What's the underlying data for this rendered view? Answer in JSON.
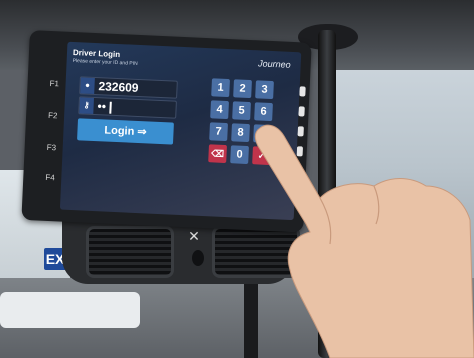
{
  "screen": {
    "title": "Driver Login",
    "subtitle": "Please enter your ID and PIN",
    "brand": "Journeo",
    "driver_id": "232609",
    "pin_mask": "••",
    "login_label": "Login ⇒",
    "function_keys": [
      "F1",
      "F2",
      "F3",
      "F4"
    ],
    "keypad": [
      "1",
      "2",
      "3",
      "4",
      "5",
      "6",
      "7",
      "8",
      "9",
      "⌫",
      "0",
      "✓"
    ]
  },
  "sign": {
    "exit_label": "EXI"
  },
  "colors": {
    "screen_bg": "#23395a",
    "key": "#4a6fa4",
    "login_button": "#3a8fd0",
    "key_action": "#c0344b"
  }
}
